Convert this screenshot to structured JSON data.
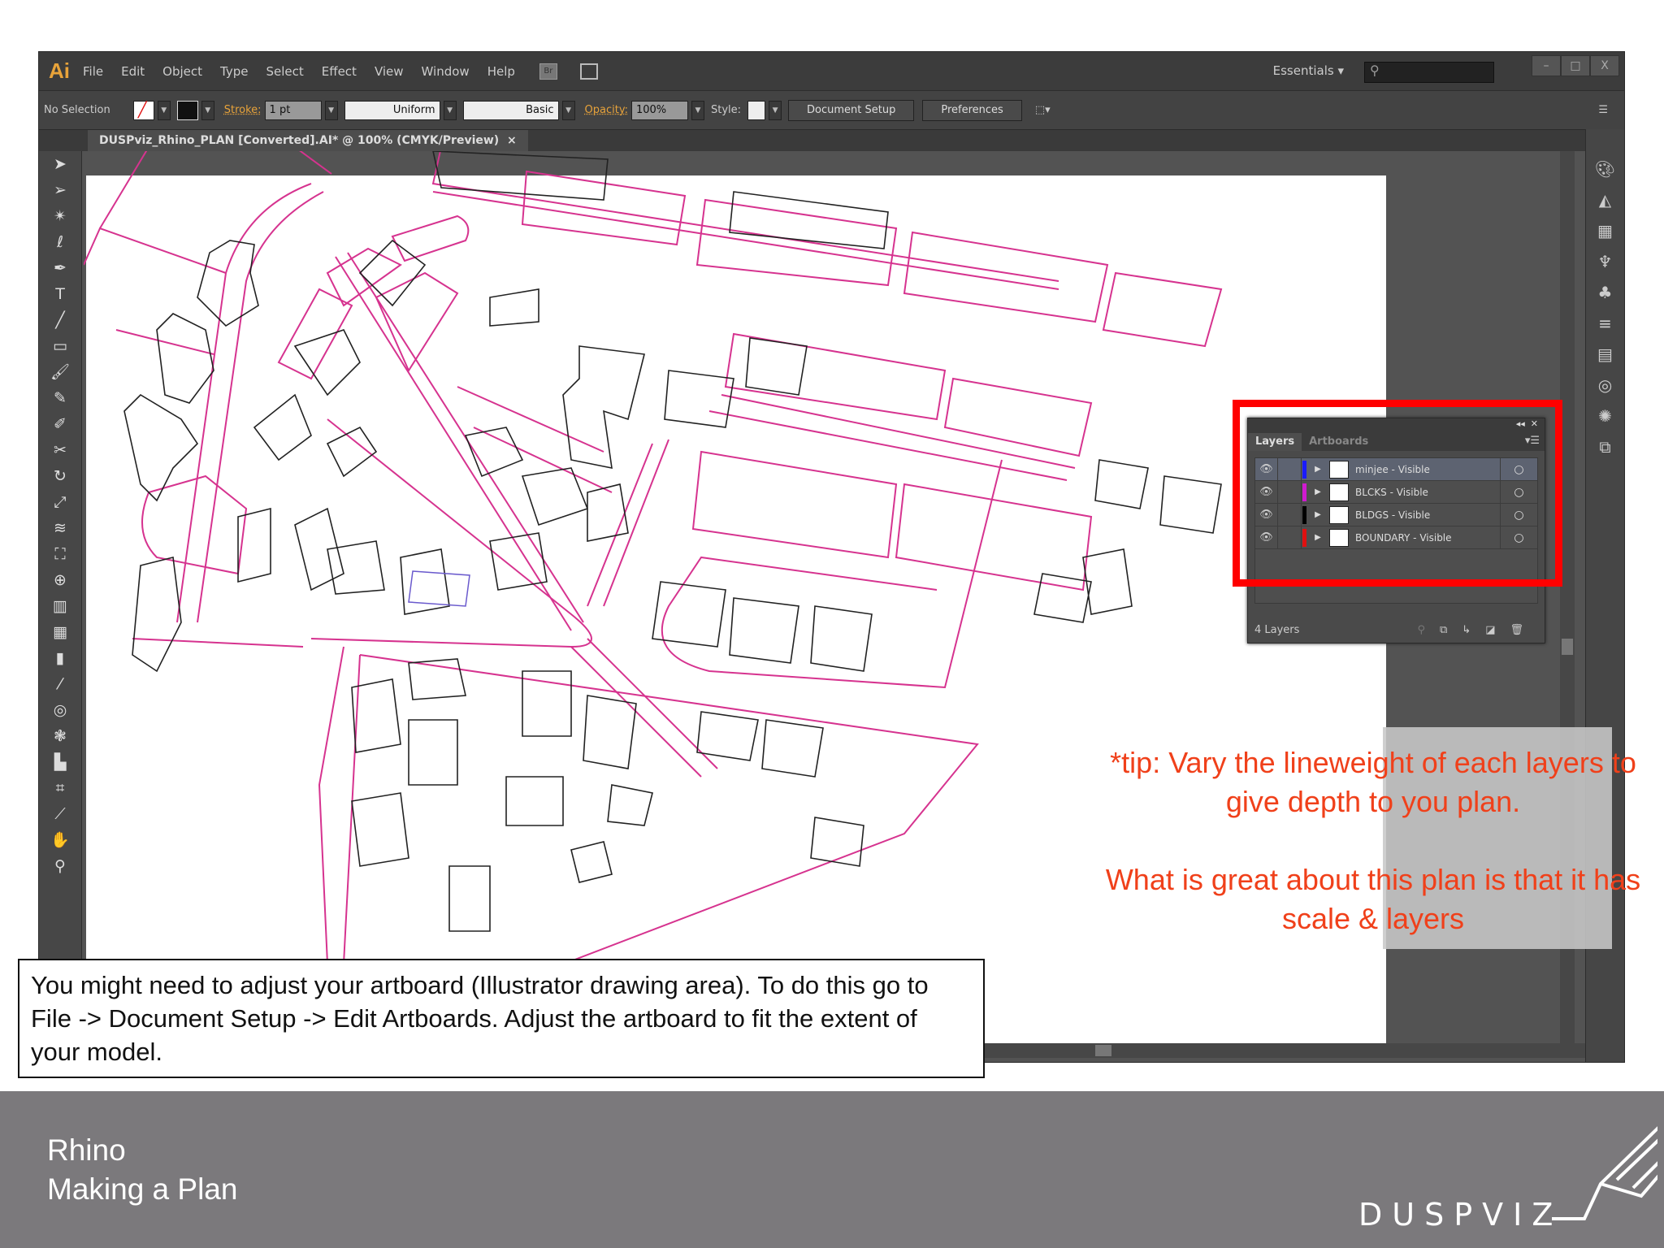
{
  "app": {
    "logo": "Ai",
    "menu": [
      "File",
      "Edit",
      "Object",
      "Type",
      "Select",
      "Effect",
      "View",
      "Window",
      "Help"
    ],
    "bridge": "Br",
    "workspace": "Essentials",
    "window_controls": [
      "–",
      "□",
      "X"
    ]
  },
  "control": {
    "selection": "No Selection",
    "stroke_label": "Stroke:",
    "stroke_value": "1 pt",
    "profile": "Uniform",
    "brush": "Basic",
    "opacity_label": "Opacity:",
    "opacity_value": "100%",
    "style_label": "Style:",
    "document_setup": "Document Setup",
    "preferences": "Preferences"
  },
  "document": {
    "tab_title": "DUSPviz_Rhino_PLAN [Converted].AI* @ 100% (CMYK/Preview)",
    "close": "×"
  },
  "tools": [
    "selection",
    "direct-selection",
    "magic-wand",
    "lasso",
    "pen",
    "type",
    "line",
    "rectangle",
    "paintbrush",
    "pencil",
    "blob-brush",
    "scissors",
    "rotate",
    "scale",
    "warp",
    "free-transform",
    "shape-builder",
    "perspective",
    "mesh",
    "gradient",
    "eyedropper",
    "blend",
    "symbol-sprayer",
    "graph",
    "artboard",
    "slice",
    "hand",
    "zoom"
  ],
  "layers_panel": {
    "tabs": [
      "Layers",
      "Artboards"
    ],
    "layers": [
      {
        "name": "minjee - Visible",
        "color": "#1a1aff",
        "selected": true
      },
      {
        "name": "BLCKS - Visible",
        "color": "#d01ad0",
        "selected": false
      },
      {
        "name": "BLDGS - Visible",
        "color": "#000000",
        "selected": false
      },
      {
        "name": "BOUNDARY - Visible",
        "color": "#e01010",
        "selected": false
      }
    ],
    "count": "4 Layers"
  },
  "annotations": {
    "tip_line1": "*tip: Vary the lineweight of each layers to",
    "tip_line2": "give depth to you plan.",
    "great_line1": "What is great about this plan is that it has",
    "great_line2": "scale & layers"
  },
  "note": "You might need to adjust your artboard (Illustrator drawing area). To do this go to File -> Document Setup -> Edit Artboards. Adjust the artboard to fit the extent of your model.",
  "footer": {
    "title": "Rhino",
    "subtitle": "Making a Plan",
    "logo_text": "DUSPVIZ"
  },
  "colors": {
    "accent": "#e8a33a",
    "highlight": "#ff0000",
    "tip": "#f0401a",
    "block_line": "#d6338f"
  }
}
